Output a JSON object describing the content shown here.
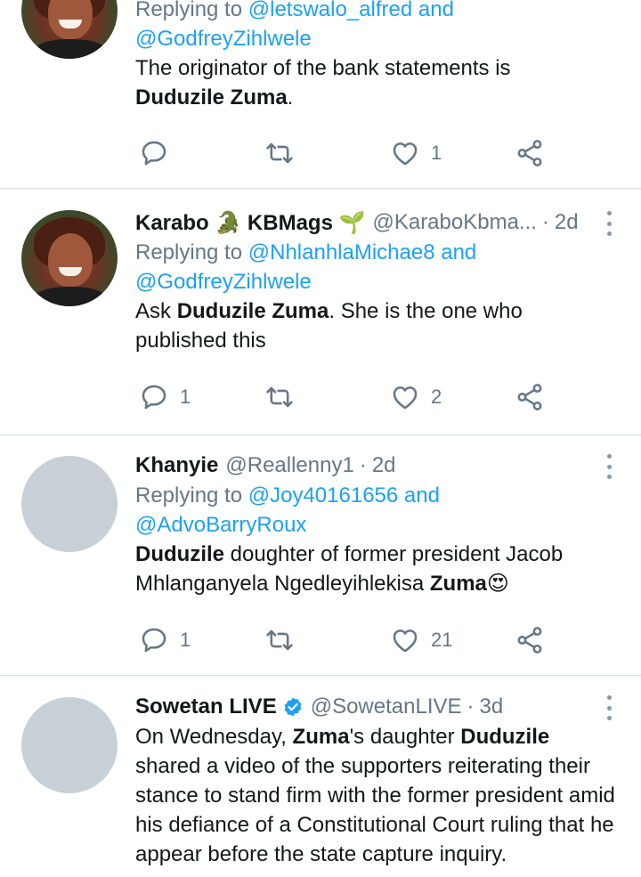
{
  "tweets": [
    {
      "reply_prefix": "Replying to ",
      "reply_to_1": "@letswalo_alfred",
      "reply_and": " and",
      "reply_to_2": "@GodfreyZihlwele",
      "text_1": "The originator of the bank statements is",
      "text_bold_1": "Duduzile Zuma",
      "text_2": ".",
      "like_count": "1"
    },
    {
      "name": "Karabo 🐊 KBMags 🌱",
      "handle": "@KaraboKbma...",
      "dot": "·",
      "time": "2d",
      "reply_prefix": "Replying to ",
      "reply_to_1": "@NhlanhlaMichae8",
      "reply_and": " and",
      "reply_to_2": "@GodfreyZihlwele",
      "text_1": "Ask ",
      "text_bold_1": "Duduzile Zuma",
      "text_2": ". She is the one who published this",
      "reply_count": "1",
      "like_count": "2"
    },
    {
      "name": "Khanyie",
      "handle": "@Reallenny1",
      "dot": "·",
      "time": "2d",
      "reply_prefix": "Replying to ",
      "reply_to_1": "@Joy40161656",
      "reply_and": " and",
      "reply_to_2": "@AdvoBarryRoux",
      "text_bold_1": "Duduzile",
      "text_1": " doughter of former president Jacob Mhlanganyela Ngedleyihlekisa ",
      "text_bold_2": "Zuma",
      "text_emoji": "😍",
      "reply_count": "1",
      "like_count": "21"
    },
    {
      "name": "Sowetan LIVE",
      "handle": "@SowetanLIVE",
      "dot": "·",
      "time": "3d",
      "text_1": "On Wednesday, ",
      "text_bold_1": "Zuma",
      "text_2": "'s daughter ",
      "text_bold_2": "Duduzile",
      "text_3": " shared a video of the supporters reiterating their stance to stand firm with the former president amid his defiance of a Constitutional Court ruling that he appear before the state capture inquiry."
    }
  ],
  "icons": {
    "reply": "reply-icon",
    "retweet": "retweet-icon",
    "like": "heart-icon",
    "share": "share-icon",
    "more": "more-vertical-icon",
    "verified": "verified-badge-icon"
  },
  "colors": {
    "link": "#1da1f2",
    "secondary": "#657786",
    "icon": "#657786",
    "divider": "#d9dee2",
    "avatar_placeholder": "#c7d0d6"
  }
}
